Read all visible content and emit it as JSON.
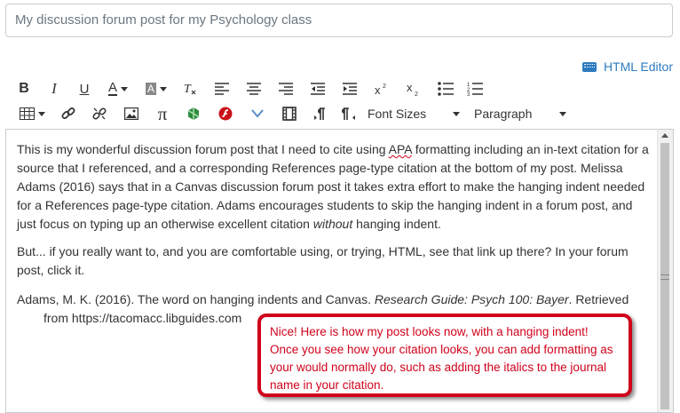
{
  "title_field": {
    "value": "My discussion forum post for my Psychology class"
  },
  "html_editor_link": "HTML Editor",
  "toolbar": {
    "font_sizes_label": "Font Sizes",
    "format_label": "Paragraph"
  },
  "content": {
    "paragraph1_before_apa": "This is my wonderful discussion forum post that I need to cite using ",
    "apa": "APA",
    "paragraph1_middle": " formatting including an in-text citation for a source that I referenced, and a corresponding References page-type citation at the bottom of my post. Melissa Adams (2016) says that in a Canvas discussion forum post it takes extra effort to make the hanging indent needed for a References page-type citation. Adams encourages students to skip the hanging indent in a forum post, and just focus on typing up an otherwise excellent citation ",
    "without": "without",
    "paragraph1_end": " hanging indent.",
    "paragraph2": "But... if you really want to, and you are comfortable using, or trying, HTML, see that link up there? In your forum post, click it.",
    "reference_start": "Adams, M. K. (2016). The word on hanging indents and Canvas. ",
    "reference_italic": "Research Guide: Psych 100: Bayer",
    "reference_end": ". Retrieved from https://tacomacc.libguides.com"
  },
  "callout": {
    "text": "Nice! Here is how my post looks now, with a hanging indent! Once you see how your citation looks, you can add formatting as your would normally do, such as adding the italics to the journal name in your citation."
  },
  "colors": {
    "link": "#2d7bbf",
    "callout": "#d0021b",
    "border": "#c7cdd1"
  }
}
